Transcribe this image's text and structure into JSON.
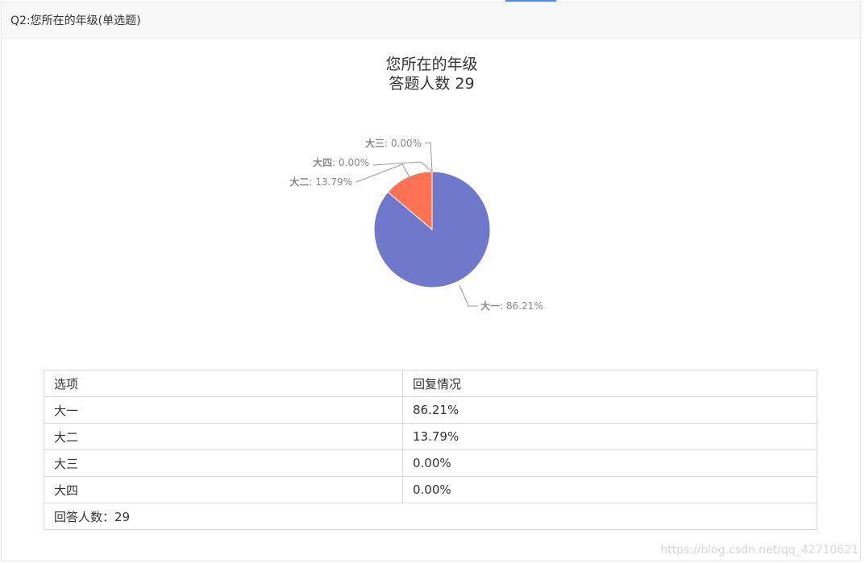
{
  "header": {
    "question_title": "Q2:您所在的年级(单选题)"
  },
  "chart_data": {
    "type": "pie",
    "title": "您所在的年级",
    "subtitle": "答题人数 29",
    "slices": [
      {
        "label": "大一",
        "value": 86.21,
        "display": "86.21%",
        "color": "#7078cc"
      },
      {
        "label": "大二",
        "value": 13.79,
        "display": "13.79%",
        "color": "#ff7353"
      },
      {
        "label": "大三",
        "value": 0.0,
        "display": "0.00%",
        "color": "#888888"
      },
      {
        "label": "大四",
        "value": 0.0,
        "display": "0.00%",
        "color": "#888888"
      }
    ]
  },
  "table": {
    "headers": [
      "选项",
      "回复情况"
    ],
    "rows": [
      [
        "大一",
        "86.21%"
      ],
      [
        "大二",
        "13.79%"
      ],
      [
        "大三",
        "0.00%"
      ],
      [
        "大四",
        "0.00%"
      ]
    ],
    "footer": "回答人数：29"
  },
  "watermark": "https://blog.csdn.net/qq_42710621"
}
